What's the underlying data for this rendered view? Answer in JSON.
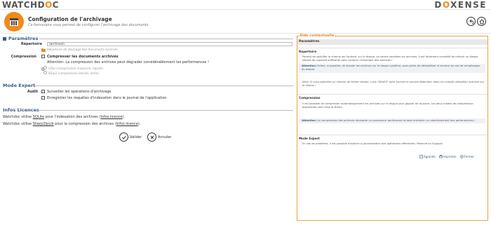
{
  "brand": {
    "left_main": "WATCHD",
    "left_accent": "O",
    "left_accent2": "C",
    "right_main": "D",
    "right_accent": "O",
    "right_rest": "XENSE"
  },
  "header": {
    "title": "Configuration de l'archivage",
    "subtitle": "Ce formulaire vous permet de configurer l'archivage des documents"
  },
  "params": {
    "section_title": "Paramètres",
    "repertoire_label": "Répertoire",
    "repertoire_value": "\\archives\\",
    "repertoire_help": "Répertoire de stockage des documents archivés",
    "compression_label": "Compression",
    "compress_option": "Compresser les documents archivés",
    "compress_warning": "Attention: La compression des archives peut dégrader considérablement les performances !",
    "opt_gzip": "GZip (compression moyenne, rapide)",
    "opt_bzip2": "BZip2 (compression élevée, lente)"
  },
  "expert": {
    "section_title": "Mode Expert",
    "audit_label": "Audit",
    "opt_surveiller": "Surveiller les opérations d'archivage",
    "opt_enregistrer": "Enregistrer les requêtes d'indexation dans le journal de l'application"
  },
  "licences": {
    "section_title": "Infos Licences",
    "line1_pre": "Watchdoc utilise ",
    "line1_link": "SQLite",
    "line1_mid": " pour l'indexation des archives (",
    "line1_info": "Infos licence",
    "line1_post": ").",
    "line2_pre": "Watchdoc utilise ",
    "line2_link": "SharpZipLib",
    "line2_mid": " pour la compression des archives (",
    "line2_info": "Infos licence",
    "line2_post": ")."
  },
  "actions": {
    "validate": "Valider",
    "cancel": "Annuler"
  },
  "aside": {
    "heading": "Aide contextuelle",
    "bar": "Paramètres",
    "t_repertoire": "Repertoire",
    "p_repertoire": "Permet de spécifier le chemin de l'endroit, sur le disque, où seront stockées les archives. Il est fortement conseillé de prévoir un disque séparé de capacité suffisante pour contenir l'ensemble des archives !",
    "n_repertoire_b": "Attention:",
    "n_repertoire": " Evitez, si possible, de stocker les archives sur le disque système, sous peine de déstabiliser le serveur en cas de remplissage du disque.",
    "p_reseau": "Note: Si vous spécifiez un chemin de fichier réseau, vous \"DEVEZ\" faire tourner le service Watchdoc dans un compte utilisateur autorisé sur le réseau !",
    "t_compression": "Compression",
    "p_compression": "Il est possible de compresser automatiquement les archives sur le disque pour gagner de la place. Les deux modes de compression disponibles sont GZip et BZip2.",
    "n_compression_b": "Attention:",
    "n_compression": " La compression des archives nécessite un processeur performant et peut entraîner un ralentissement des performances !",
    "t_expert": "Mode Expert",
    "p_expert": "En cas de problème, il est possible d'activer la journalisation des opérations effectuées. Réservé au Support.",
    "btn_agrandir": "Agrandir",
    "btn_imprimer": "Imprimer",
    "btn_fermer": "Fermer"
  },
  "colors": {
    "accent": "#f08a1c",
    "section_blue": "#3a5a8a"
  }
}
